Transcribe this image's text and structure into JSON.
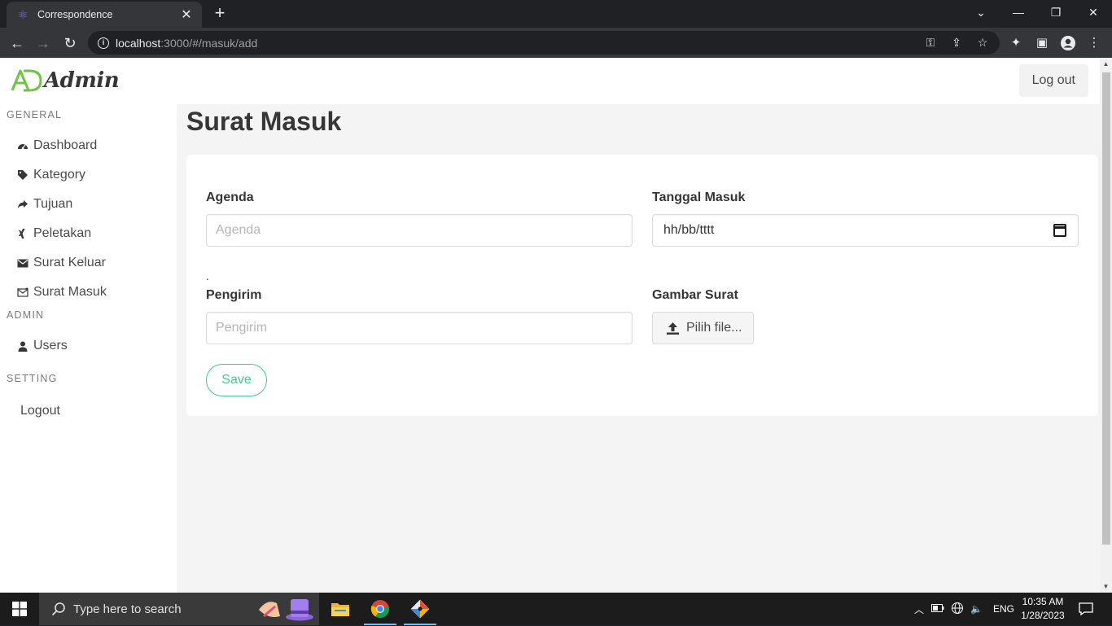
{
  "browser": {
    "tab_title": "Correspondence",
    "url_host": "localhost",
    "url_path": ":3000/#/masuk/add"
  },
  "navbar": {
    "logo_text": "Admin",
    "logout_label": "Log out"
  },
  "sidebar": {
    "general_label": "GENERAL",
    "admin_label": "ADMIN",
    "setting_label": "SETTING",
    "items": [
      {
        "label": "Dashboard",
        "icon": "dashboard-icon"
      },
      {
        "label": "Kategory",
        "icon": "tags-icon"
      },
      {
        "label": "Tujuan",
        "icon": "share-icon"
      },
      {
        "label": "Peletakan",
        "icon": "xing-icon"
      },
      {
        "label": "Surat Keluar",
        "icon": "envelope-icon"
      },
      {
        "label": "Surat Masuk",
        "icon": "envelope-open-icon"
      }
    ],
    "admin_items": [
      {
        "label": "Users",
        "icon": "user-icon"
      }
    ],
    "setting_items": [
      {
        "label": "Logout"
      }
    ]
  },
  "main": {
    "title": "Surat Masuk",
    "form": {
      "agenda_label": "Agenda",
      "agenda_placeholder": "Agenda",
      "tanggal_label": "Tanggal Masuk",
      "tanggal_value": "hh/bb/tttt",
      "dot": ".",
      "pengirim_label": "Pengirim",
      "pengirim_placeholder": "Pengirim",
      "gambar_label": "Gambar Surat",
      "file_button_label": "Pilih file...",
      "save_label": "Save"
    }
  },
  "taskbar": {
    "search_placeholder": "Type here to search",
    "language": "ENG",
    "time": "10:35 AM",
    "date": "1/28/2023"
  },
  "colors": {
    "accent_green": "#48c78e",
    "logo_green": "#6cc644",
    "page_bg": "#f4f4f4"
  }
}
